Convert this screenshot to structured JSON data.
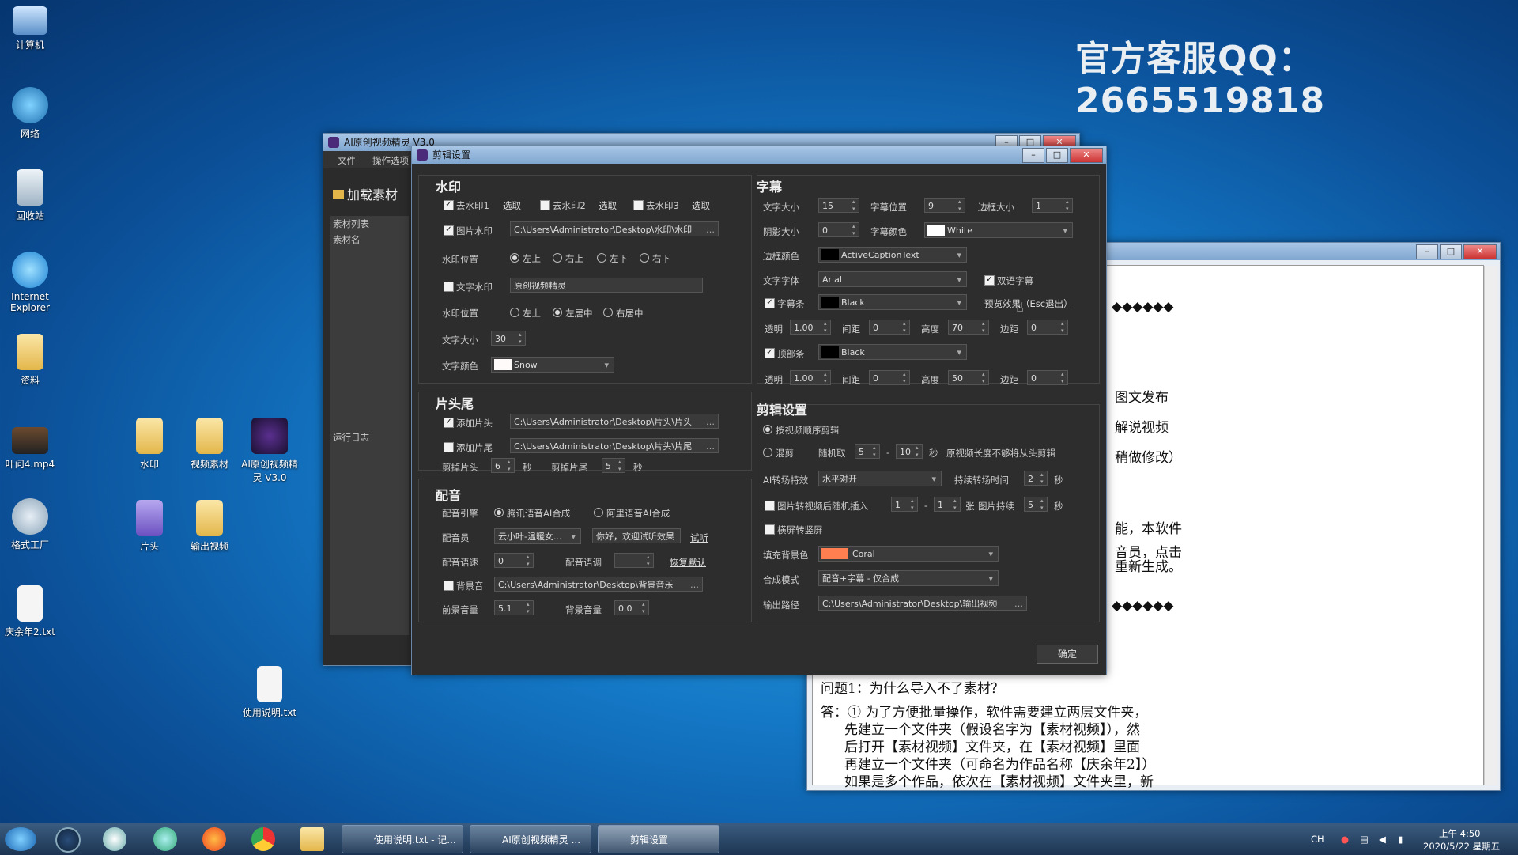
{
  "desktop": {
    "watermark": "官方客服QQ：2665519818",
    "icons": [
      {
        "label": "计算机",
        "icon": "computer-icon"
      },
      {
        "label": "网络",
        "icon": "network-icon"
      },
      {
        "label": "回收站",
        "icon": "recycle-bin-icon"
      },
      {
        "label": "Internet Explorer",
        "icon": "ie-icon"
      },
      {
        "label": "资料",
        "icon": "folder-icon"
      },
      {
        "label": "叶问4.mp4",
        "icon": "video-file-icon"
      },
      {
        "label": "格式工厂",
        "icon": "format-factory-icon"
      },
      {
        "label": "庆余年2.txt",
        "icon": "text-file-icon"
      },
      {
        "label": "水印",
        "icon": "folder-icon"
      },
      {
        "label": "视频素材",
        "icon": "folder-icon"
      },
      {
        "label": "AI原创视频精灵 V3.0",
        "icon": "app-icon"
      },
      {
        "label": "片头",
        "icon": "folder-icon"
      },
      {
        "label": "输出视频",
        "icon": "folder-icon"
      },
      {
        "label": "使用说明.txt",
        "icon": "text-file-icon"
      }
    ]
  },
  "main_window": {
    "title": "AI原创视频精灵 V3.0",
    "menu": [
      "文件",
      "操作选项"
    ],
    "load_button": "加载素材",
    "list_header": "素材列表",
    "list_column": "素材名",
    "log_label": "运行日志"
  },
  "dialog": {
    "title": "剪辑设置",
    "watermark": {
      "section": "水印",
      "remove1": "去水印1",
      "remove2": "去水印2",
      "remove3": "去水印3",
      "select": "选取",
      "image_wm": "图片水印",
      "image_path": "C:\\Users\\Administrator\\Desktop\\水印\\水印",
      "pos_label": "水印位置",
      "pos1": [
        "左上",
        "右上",
        "左下",
        "右下"
      ],
      "text_wm": "文字水印",
      "text_value": "原创视频精灵",
      "pos2": [
        "左上",
        "左居中",
        "右居中"
      ],
      "font_size_label": "文字大小",
      "font_size": "30",
      "color_label": "文字颜色",
      "color_name": "Snow",
      "color_hex": "#fffafa"
    },
    "header_footer": {
      "section": "片头尾",
      "add_head": "添加片头",
      "head_path": "C:\\Users\\Administrator\\Desktop\\片头\\片头",
      "add_tail": "添加片尾",
      "tail_path": "C:\\Users\\Administrator\\Desktop\\片头\\片尾",
      "cut_head": "剪掉片头",
      "cut_head_val": "6",
      "cut_tail": "剪掉片尾",
      "cut_tail_val": "5",
      "sec": "秒"
    },
    "dubbing": {
      "section": "配音",
      "engine_label": "配音引擎",
      "engine1": "腾讯语音AI合成",
      "engine2": "阿里语音AI合成",
      "voice_label": "配音员",
      "voice": "云小叶-温暖女...",
      "sample_text": "你好，欢迎试听效果",
      "try": "试听",
      "speed_label": "配音语速",
      "speed": "0",
      "tone_label": "配音语调",
      "tone": "",
      "reset": "恢复默认",
      "bgm": "背景音",
      "bgm_path": "C:\\Users\\Administrator\\Desktop\\背景音乐",
      "fg_vol_label": "前景音量",
      "fg_vol": "5.1",
      "bg_vol_label": "背景音量",
      "bg_vol": "0.0"
    },
    "subtitle": {
      "section": "字幕",
      "font_size_label": "文字大小",
      "font_size": "15",
      "pos_label": "字幕位置",
      "pos": "9",
      "border_label": "边框大小",
      "border": "1",
      "shadow_label": "阴影大小",
      "shadow": "0",
      "color_label": "字幕颜色",
      "color_name": "White",
      "color_hex": "#ffffff",
      "border_color_label": "边框颜色",
      "border_color": "ActiveCaptionText",
      "border_color_hex": "#000000",
      "font_label": "文字字体",
      "font": "Arial",
      "bilingual": "双语字幕",
      "bar": "字幕条",
      "bar_color": "Black",
      "bar_color_hex": "#000000",
      "preview": "预览效果（Esc退出）",
      "alpha_label": "透明",
      "gap_label": "间距",
      "height_label": "高度",
      "margin_label": "边距",
      "row1": {
        "alpha": "1.00",
        "gap": "0",
        "height": "70",
        "margin": "0"
      },
      "top_bar": "顶部条",
      "top_color": "Black",
      "top_color_hex": "#000000",
      "row2": {
        "alpha": "1.00",
        "gap": "0",
        "height": "50",
        "margin": "0"
      }
    },
    "edit": {
      "section": "剪辑设置",
      "order": "按视频顺序剪辑",
      "mix": "混剪",
      "random": "随机取",
      "r_from": "5",
      "r_to": "10",
      "sec": "秒",
      "note": "原视频长度不够将从头剪辑",
      "transition_label": "AI转场特效",
      "transition": "水平对开",
      "duration_label": "持续转场时间",
      "duration": "2",
      "img_insert": "图片转视频后随机插入",
      "img_from": "1",
      "img_to": "1",
      "img_unit": "张",
      "img_dur_label": "图片持续",
      "img_dur": "5",
      "landscape": "横屏转竖屏",
      "fill_label": "填充背景色",
      "fill": "Coral",
      "fill_hex": "#ff7f50",
      "mode_label": "合成模式",
      "mode": "配音+字幕 - 仅合成",
      "out_label": "输出路径",
      "out_path": "C:\\Users\\Administrator\\Desktop\\输出视频"
    },
    "ok": "确定"
  },
  "notepad": {
    "lines_right": [
      "图文发布",
      "解说视频",
      "稍做修改）",
      "能，本软件",
      "音员，点击",
      "重新生成。"
    ],
    "diamonds": "◆◆◆◆◆◆",
    "q1": "问题1：为什么导入不了素材？",
    "a1": [
      "答：① 为了方便批量操作，软件需要建立两层文件夹，",
      "先建立一个文件夹（假设名字为【素材视频】），然",
      "后打开【素材视频】文件夹，在【素材视频】里面",
      "再建立一个文件夹（可命名为作品名称【庆余年2】）",
      "如果是多个作品，依次在【素材视频】文件夹里，新"
    ]
  },
  "taskbar": {
    "tasks": [
      "使用说明.txt - 记...",
      "AI原创视频精灵 ...",
      "剪辑设置"
    ],
    "lang": "CH",
    "time": "上午 4:50",
    "date": "2020/5/22 星期五"
  }
}
